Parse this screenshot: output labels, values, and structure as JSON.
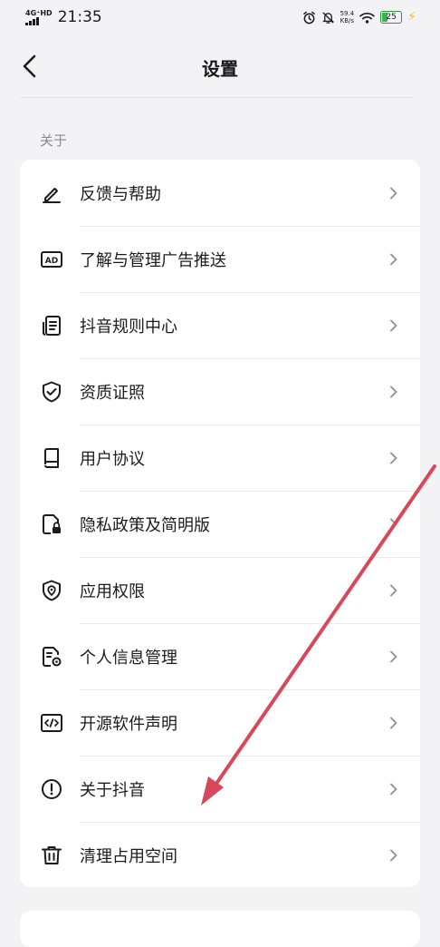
{
  "status_bar": {
    "network": "4G⁺HD",
    "time": "21:35",
    "speed_value": "59.4",
    "speed_unit": "KB/s",
    "battery": "25"
  },
  "header": {
    "title": "设置"
  },
  "section": {
    "label": "关于"
  },
  "menu": {
    "items": [
      {
        "label": "反馈与帮助",
        "icon": "pencil-icon"
      },
      {
        "label": "了解与管理广告推送",
        "icon": "ad-icon"
      },
      {
        "label": "抖音规则中心",
        "icon": "rules-document-icon"
      },
      {
        "label": "资质证照",
        "icon": "shield-check-icon"
      },
      {
        "label": "用户协议",
        "icon": "book-icon"
      },
      {
        "label": "隐私政策及简明版",
        "icon": "document-lock-icon"
      },
      {
        "label": "应用权限",
        "icon": "shield-location-icon"
      },
      {
        "label": "个人信息管理",
        "icon": "document-gear-icon"
      },
      {
        "label": "开源软件声明",
        "icon": "code-icon"
      },
      {
        "label": "关于抖音",
        "icon": "info-exclamation-icon"
      },
      {
        "label": "清理占用空间",
        "icon": "trash-icon"
      }
    ]
  },
  "colors": {
    "background": "#f3f3f5",
    "card": "#ffffff",
    "annotation_arrow": "#d9485a"
  }
}
